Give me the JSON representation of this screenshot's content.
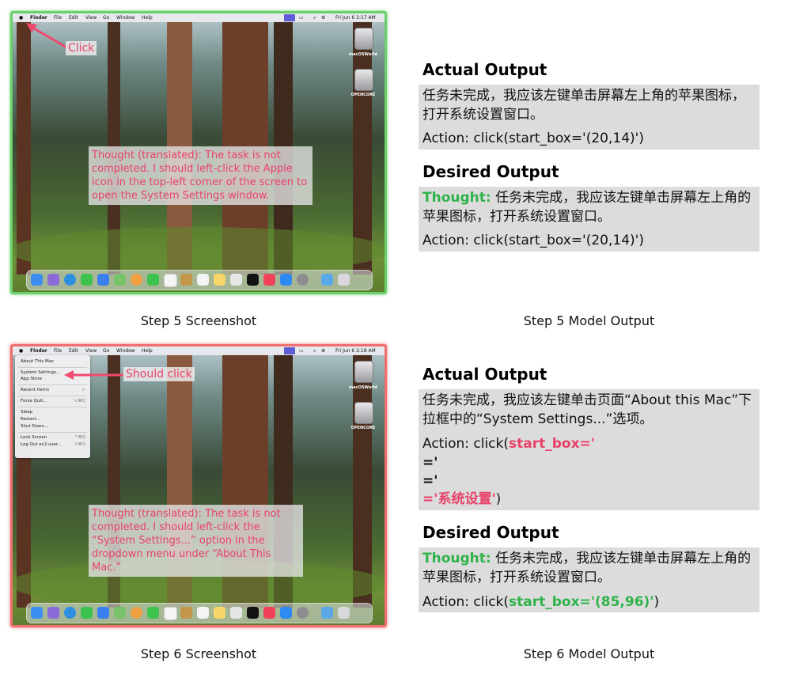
{
  "step5": {
    "menubar": {
      "apple": "",
      "app": "Finder",
      "menus": [
        "File",
        "Edit",
        "View",
        "Go",
        "Window",
        "Help"
      ],
      "status": "Fri Jun 6  2:17 AM"
    },
    "desktop_icons": [
      "macOSWorld",
      "OPENCORE"
    ],
    "callout": "Click",
    "thought": "Thought (translated): The task is not completed. I should left-click the Apple icon in the top-left corner of the screen to open the System Settings window.",
    "caption": "Step 5 Screenshot",
    "actual_heading": "Actual Output",
    "actual_text": "任务未完成，我应该左键单击屏幕左上角的苹果图标，打开系统设置窗口。",
    "actual_action": "Action: click(start_box='(20,14)')",
    "desired_heading": "Desired Output",
    "desired_label": "Thought:",
    "desired_text": "任务未完成，我应该左键单击屏幕左上角的苹果图标，打开系统设置窗口。",
    "desired_action": "Action: click(start_box='(20,14)')",
    "output_caption": "Step 5 Model Output"
  },
  "step6": {
    "menubar": {
      "apple": "",
      "app": "Finder",
      "menus": [
        "File",
        "Edit",
        "View",
        "Go",
        "Window",
        "Help"
      ],
      "status": "Fri Jun 6  2:18 AM"
    },
    "desktop_icons": [
      "macOSWorld",
      "OPENCORE"
    ],
    "apple_menu": [
      {
        "label": "About This Mac",
        "shortcut": ""
      },
      {
        "label": "System Settings...",
        "shortcut": ""
      },
      {
        "label": "App Store",
        "shortcut": ""
      },
      {
        "label": "Recent Items",
        "shortcut": ">"
      },
      {
        "label": "Force Quit...",
        "shortcut": "⌥⌘Q"
      },
      {
        "label": "Sleep",
        "shortcut": ""
      },
      {
        "label": "Restart...",
        "shortcut": ""
      },
      {
        "label": "Shut Down...",
        "shortcut": ""
      },
      {
        "label": "Lock Screen",
        "shortcut": "^⌘Q"
      },
      {
        "label": "Log Out ec2-user...",
        "shortcut": "⇧⌘Q"
      }
    ],
    "callout": "Should click",
    "thought": "Thought (translated): The task is not completed. I should left-click the “System Settings...” option in the dropdown menu under “About This Mac.”",
    "caption": "Step 6 Screenshot",
    "actual_heading": "Actual Output",
    "actual_text": "任务未完成，我应该左键单击页面“About this Mac”下拉框中的“System Settings...”选项。",
    "actual_action_prefix": "Action: click(",
    "actual_action_bad1": "start_box='",
    "actual_action_bad2": "='",
    "actual_action_bad3": "='",
    "actual_action_bad4": "='系统设置'",
    "actual_action_suffix": ")",
    "desired_heading": "Desired Output",
    "desired_label": "Thought:",
    "desired_text": "任务未完成，我应该左键单击屏幕左上角的苹果图标，打开系统设置窗口。",
    "desired_action_prefix": "Action: click(",
    "desired_action_good": "start_box='(85,96)'",
    "desired_action_suffix": ")",
    "output_caption": "Step 6 Model Output"
  },
  "colors": {
    "success_border": "#6ad06a",
    "fail_border": "#ef6f6f",
    "highlight_red": "#e8426a",
    "highlight_green": "#2fb34a"
  }
}
